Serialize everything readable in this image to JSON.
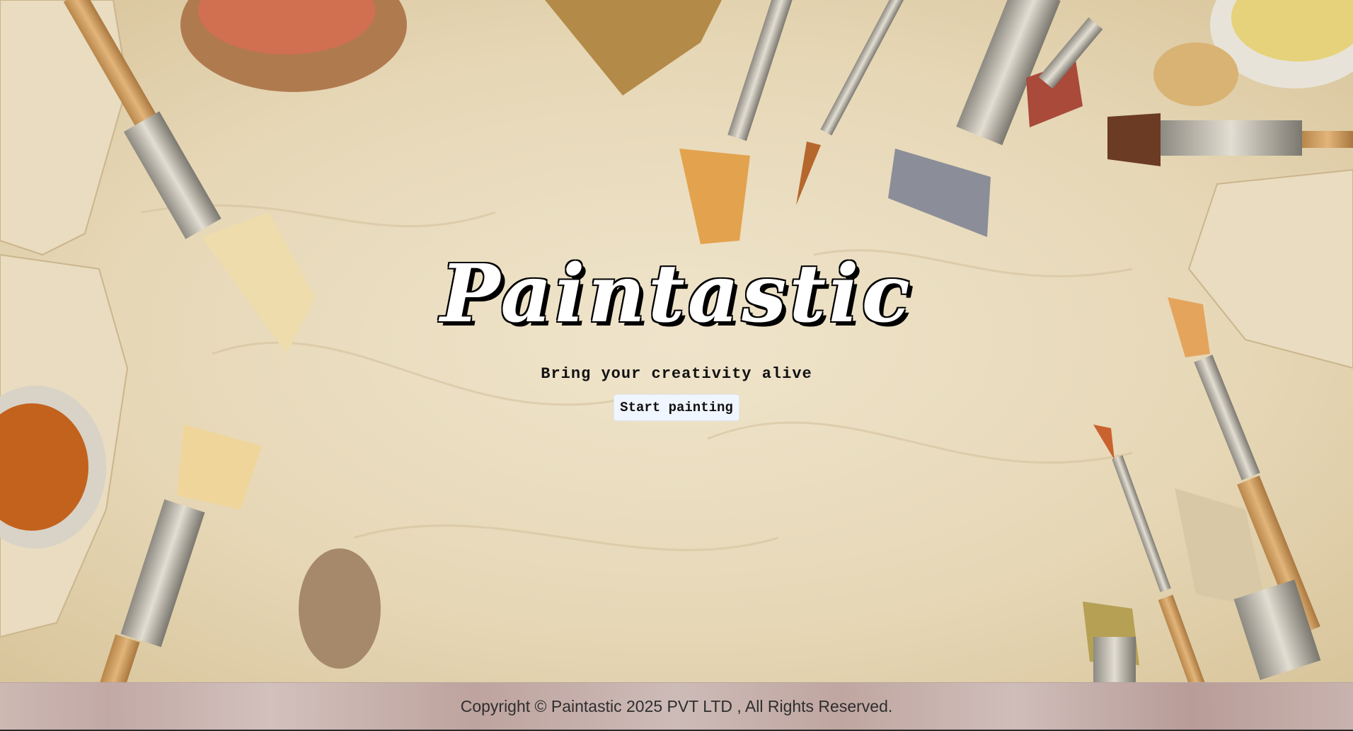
{
  "hero": {
    "title": "Paintastic",
    "tagline": "Bring your creativity alive",
    "cta_label": "Start painting"
  },
  "footer": {
    "copyright": "Copyright © Paintastic 2025 PVT LTD , All Rights Reserved."
  }
}
